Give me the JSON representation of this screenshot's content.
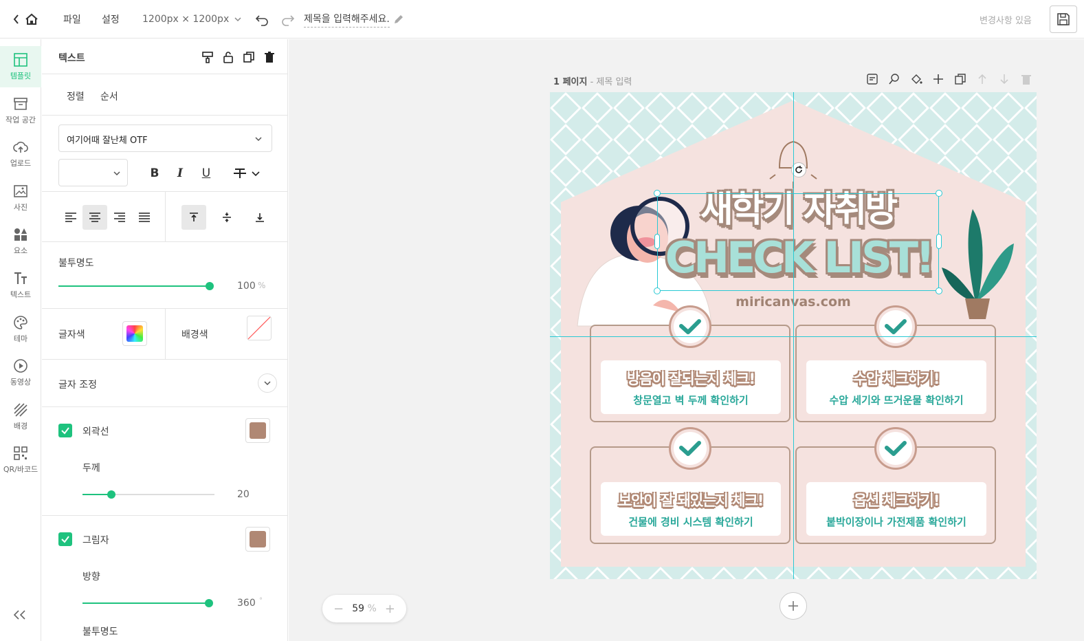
{
  "topbar": {
    "file": "파일",
    "settings": "설정",
    "size": "1200px × 1200px",
    "title": "제목을 입력해주세요.",
    "status": "변경사항 있음"
  },
  "nav": {
    "items": [
      {
        "label": "템플릿",
        "icon": "template-icon",
        "active": true
      },
      {
        "label": "작업 공간",
        "icon": "archive-icon"
      },
      {
        "label": "업로드",
        "icon": "upload-cloud-icon"
      },
      {
        "label": "사진",
        "icon": "photo-icon"
      },
      {
        "label": "요소",
        "icon": "shapes-icon"
      },
      {
        "label": "텍스트",
        "icon": "text-icon"
      },
      {
        "label": "테마",
        "icon": "palette-icon"
      },
      {
        "label": "동영상",
        "icon": "play-circle-icon"
      },
      {
        "label": "배경",
        "icon": "background-icon"
      },
      {
        "label": "QR/바코드",
        "icon": "qr-icon"
      }
    ]
  },
  "panel": {
    "title": "텍스트",
    "tab_align": "정렬",
    "tab_order": "순서",
    "font": "여기어때 잘난체 OTF",
    "opacity_label": "불투명도",
    "opacity_value": "100",
    "opacity_unit": "%",
    "opacity_fraction": 1.0,
    "text_color_label": "글자색",
    "bg_color_label": "배경색",
    "text_adjust_label": "글자 조정",
    "outline_label": "외곽선",
    "outline_color": "#b08874",
    "thickness_label": "두께",
    "thickness_value": "20",
    "thickness_fraction": 0.22,
    "shadow_label": "그림자",
    "shadow_color": "#b08874",
    "direction_label": "방향",
    "direction_value": "360",
    "direction_unit": "°",
    "direction_fraction": 1.0,
    "shadow_opacity_label": "불투명도"
  },
  "canvas": {
    "page_label": "1 페이지",
    "page_title_placeholder": "제목 입력",
    "zoom": "59",
    "zoom_unit": "%"
  },
  "design": {
    "headline": "새학기 자취방",
    "headline2": "CHECK LIST!",
    "website": "miricanvas.com",
    "cards": [
      {
        "title": "방음이 잘되는지 체크!",
        "sub": "창문열고 벽 두께 확인하기"
      },
      {
        "title": "수압 체크하기!",
        "sub": "수압 세기와 뜨거운물 확인하기"
      },
      {
        "title": "보안이 잘 돼있는지 체크!",
        "sub": "건물에 경비 시스템 확인하기"
      },
      {
        "title": "옵션 체크하기!",
        "sub": "붙박이장이나 가전제품 확인하기"
      }
    ]
  }
}
